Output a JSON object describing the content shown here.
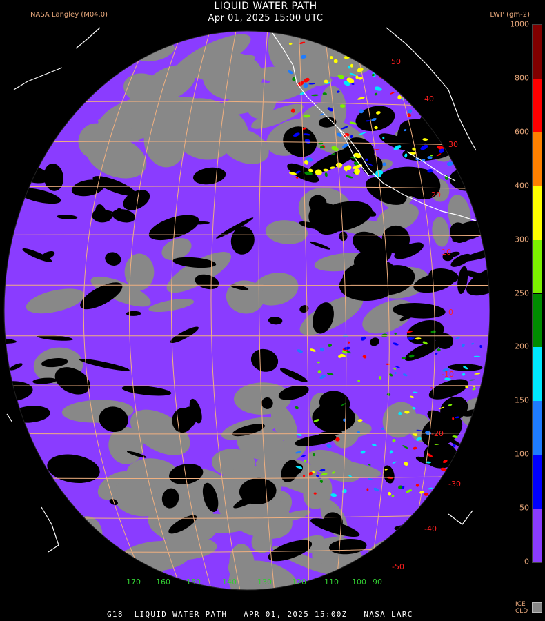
{
  "header": {
    "title": "LIQUID WATER PATH",
    "subtitle": "Apr 01, 2025 15:00 UTC",
    "credit": "NASA Langley (M04.0)",
    "unit_label": "LWP (gm-2)"
  },
  "footer": {
    "caption": "G18  LIQUID WATER PATH   APR 01, 2025 15:00Z   NASA LARC"
  },
  "colorbar": {
    "segments": [
      {
        "from": 0,
        "to": 50,
        "color": "#8a3cff"
      },
      {
        "from": 50,
        "to": 100,
        "color": "#0000ff"
      },
      {
        "from": 100,
        "to": 150,
        "color": "#1e7cff"
      },
      {
        "from": 150,
        "to": 200,
        "color": "#00e8ff"
      },
      {
        "from": 200,
        "to": 250,
        "color": "#008c00"
      },
      {
        "from": 250,
        "to": 300,
        "color": "#7cf000"
      },
      {
        "from": 300,
        "to": 400,
        "color": "#ffff00"
      },
      {
        "from": 400,
        "to": 600,
        "color": "#ff8000"
      },
      {
        "from": 600,
        "to": 800,
        "color": "#ff0000"
      },
      {
        "from": 800,
        "to": 1000,
        "color": "#800000"
      }
    ],
    "ticks": [
      "0",
      "50",
      "100",
      "150",
      "200",
      "250",
      "300",
      "400",
      "600",
      "800",
      "1000"
    ],
    "ice_label_1": "ICE",
    "ice_label_2": "CLD",
    "ice_color": "#888888"
  },
  "map": {
    "latitude_labels": [
      "50",
      "40",
      "30",
      "20",
      "10",
      "0",
      "-10",
      "-20",
      "-30",
      "-40",
      "-50"
    ],
    "longitude_labels": [
      "170",
      "160",
      "150",
      "140",
      "130",
      "120",
      "110",
      "100",
      "90"
    ],
    "grid_color": "#f0b080",
    "lat_label_color": "#ff2020",
    "lon_label_color": "#33cc33",
    "clear_color": "#000000",
    "liquid_low_color": "#8a3cff",
    "ice_color": "#888888"
  }
}
